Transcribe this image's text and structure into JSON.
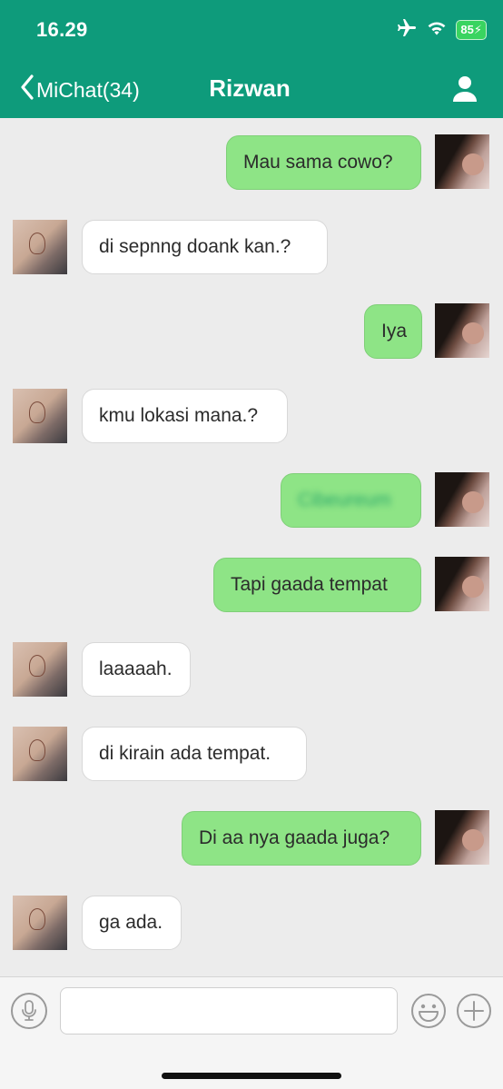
{
  "status_bar": {
    "time": "16.29",
    "battery": "85",
    "icons": [
      "airplane-icon",
      "wifi-icon",
      "battery-charging-icon"
    ]
  },
  "header": {
    "back_label": "MiChat(34)",
    "title": "Rizwan",
    "profile_icon": "person-icon"
  },
  "colors": {
    "header": "#0e9b7b",
    "outgoing_bubble": "#8ee486",
    "incoming_bubble": "#ffffff",
    "background": "#ececec"
  },
  "messages": [
    {
      "direction": "out",
      "text": "Mau sama cowo?"
    },
    {
      "direction": "in",
      "text": "di sepnng doank kan.?"
    },
    {
      "direction": "out",
      "text": "Iya"
    },
    {
      "direction": "in",
      "text": "kmu lokasi mana.?"
    },
    {
      "direction": "out",
      "text": "Cibeureum",
      "blurred": true
    },
    {
      "direction": "out",
      "text": "Tapi gaada tempat"
    },
    {
      "direction": "in",
      "text": "laaaaah."
    },
    {
      "direction": "in",
      "text": "di kirain ada tempat."
    },
    {
      "direction": "out",
      "text": "Di aa nya gaada juga?"
    },
    {
      "direction": "in",
      "text": "ga ada."
    }
  ],
  "composer": {
    "input_value": "",
    "icons": [
      "microphone-icon",
      "emoji-icon",
      "plus-icon"
    ]
  }
}
